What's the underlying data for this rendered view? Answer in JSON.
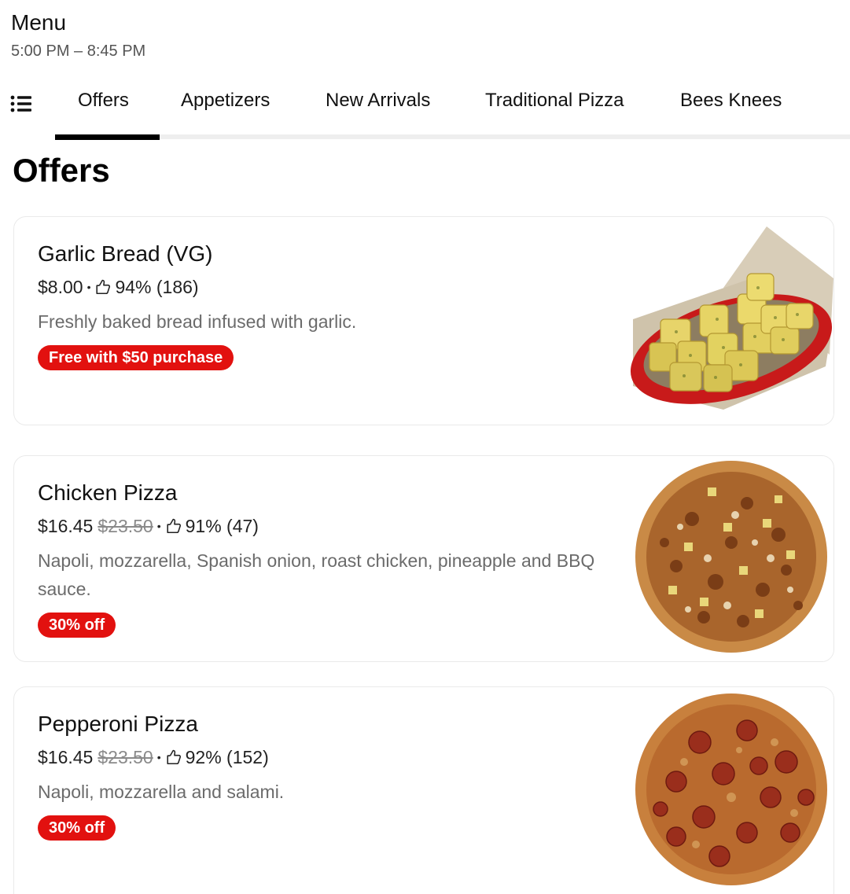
{
  "header": {
    "title": "Menu",
    "hours": "5:00 PM – 8:45 PM"
  },
  "tabs": [
    {
      "label": "Offers",
      "active": true
    },
    {
      "label": "Appetizers"
    },
    {
      "label": "New Arrivals"
    },
    {
      "label": "Traditional Pizza"
    },
    {
      "label": "Bees Knees"
    }
  ],
  "section": {
    "title": "Offers"
  },
  "items": [
    {
      "name": "Garlic Bread (VG)",
      "price": "$8.00",
      "original_price": "",
      "rating": "94% (186)",
      "description": "Freshly baked bread infused with garlic.",
      "badge": "Free with $50 purchase",
      "image": "garlic-bread-basket"
    },
    {
      "name": "Chicken Pizza",
      "price": "$16.45",
      "original_price": "$23.50",
      "rating": "91% (47)",
      "description": "Napoli, mozzarella, Spanish onion, roast chicken, pineapple and BBQ sauce.",
      "badge": "30% off",
      "image": "chicken-pizza"
    },
    {
      "name": "Pepperoni Pizza",
      "price": "$16.45",
      "original_price": "$23.50",
      "rating": "92% (152)",
      "description": "Napoli, mozzarella and salami.",
      "badge": "30% off",
      "image": "pepperoni-pizza"
    }
  ],
  "colors": {
    "badge": "#e2110f",
    "tab_indicator": "#000000",
    "muted_text": "#6b6b6b"
  }
}
